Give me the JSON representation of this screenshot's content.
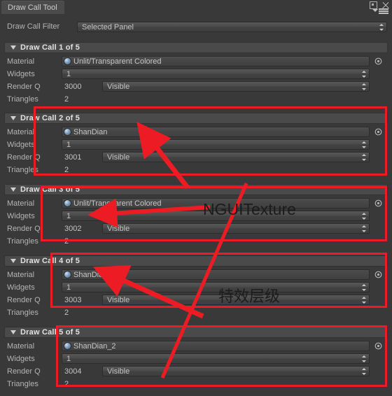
{
  "window": {
    "tab_title": "Draw Call Tool",
    "maximize_icon": "maximize-icon",
    "close_icon": "close-icon",
    "menu_icon": "hamburger-menu-icon"
  },
  "filter": {
    "label": "Draw Call Filter",
    "value": "Selected Panel"
  },
  "labels": {
    "material": "Material",
    "widgets": "Widgets",
    "render_q": "Render Q",
    "triangles": "Triangles"
  },
  "draw_calls": [
    {
      "title": "Draw Call 1 of 5",
      "material": "Unlit/Transparent Colored",
      "widgets": "1",
      "render_q": "3000",
      "visibility": "Visible",
      "triangles": "2"
    },
    {
      "title": "Draw Call 2 of 5",
      "material": "ShanDian",
      "widgets": "1",
      "render_q": "3001",
      "visibility": "Visible",
      "triangles": "2"
    },
    {
      "title": "Draw Call 3 of 5",
      "material": "Unlit/Transparent Colored",
      "widgets": "1",
      "render_q": "3002",
      "visibility": "Visible",
      "triangles": "2"
    },
    {
      "title": "Draw Call 4 of 5",
      "material": "ShanDian_1",
      "widgets": "1",
      "render_q": "3003",
      "visibility": "Visible",
      "triangles": "2"
    },
    {
      "title": "Draw Call 5 of 5",
      "material": "ShanDian_2",
      "widgets": "1",
      "render_q": "3004",
      "visibility": "Visible",
      "triangles": "2"
    }
  ],
  "annotations": {
    "color": "#ed1c24",
    "text_color": "#1c1c1c",
    "nguitexture_label": "NGUITexture",
    "effect_layer_label": "特效层级"
  }
}
